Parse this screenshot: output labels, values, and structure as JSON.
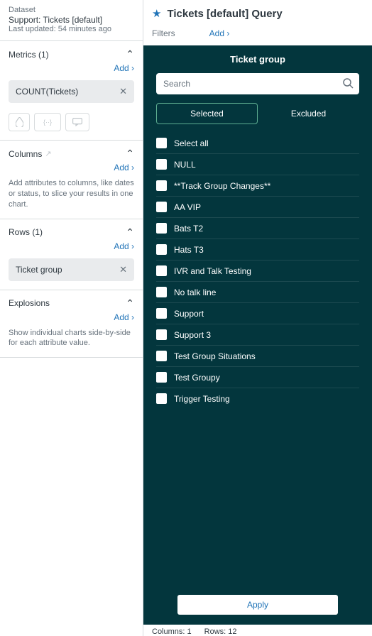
{
  "dataset": {
    "label": "Dataset",
    "name": "Support: Tickets [default]",
    "updated": "Last updated: 54 minutes ago"
  },
  "metrics": {
    "title": "Metrics (1)",
    "add": "Add ›",
    "item": "COUNT(Tickets)"
  },
  "columns": {
    "title": "Columns",
    "add": "Add ›",
    "help": "Add attributes to columns, like dates or status, to slice your results in one chart."
  },
  "rows": {
    "title": "Rows (1)",
    "add": "Add ›",
    "item": "Ticket group"
  },
  "explosions": {
    "title": "Explosions",
    "add": "Add ›",
    "help": "Show individual charts side-by-side for each attribute value."
  },
  "query": {
    "title": "Tickets [default] Query"
  },
  "filters": {
    "label": "Filters",
    "add": "Add ›"
  },
  "panel": {
    "title": "Ticket group",
    "search_placeholder": "Search",
    "tab_selected": "Selected",
    "tab_excluded": "Excluded",
    "options": [
      "Select all",
      "NULL",
      "**Track Group Changes**",
      "AA VIP",
      "Bats T2",
      "Hats T3",
      "IVR and Talk Testing",
      "No talk line",
      "Support",
      "Support 3",
      "Test Group Situations",
      "Test Groupy",
      "Trigger Testing"
    ],
    "apply": "Apply"
  },
  "footer": {
    "columns": "Columns: 1",
    "rows": "Rows: 12"
  }
}
